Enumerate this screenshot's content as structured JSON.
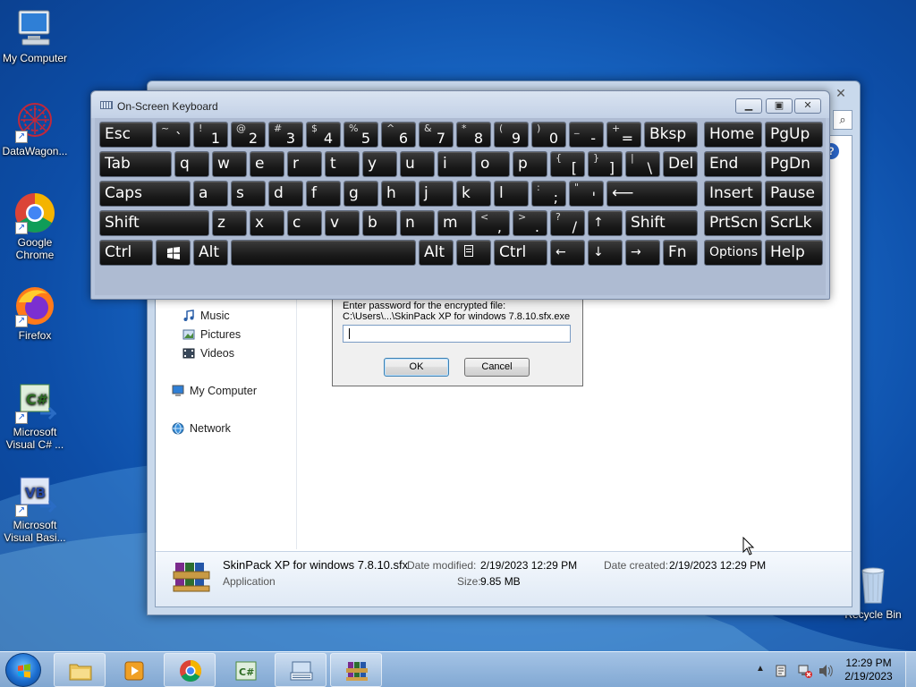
{
  "desktop": {
    "icons": [
      {
        "label": "My Computer"
      },
      {
        "label": "DataWagon..."
      },
      {
        "label": "Google Chrome"
      },
      {
        "label": "Firefox"
      },
      {
        "label": "Microsoft Visual C# ..."
      },
      {
        "label": "Microsoft Visual Basi..."
      },
      {
        "label": "Recycle Bin"
      }
    ]
  },
  "explorer": {
    "nav": [
      "Music",
      "Pictures",
      "Videos",
      "My Computer",
      "Network"
    ],
    "details": {
      "file_name": "SkinPack XP for windows 7.8.10.sfx",
      "file_type": "Application",
      "date_modified_label": "Date modified:",
      "date_modified": "2/19/2023 12:29 PM",
      "date_created_label": "Date created:",
      "date_created": "2/19/2023 12:29 PM",
      "size_label": "Size:",
      "size": "9.85 MB"
    }
  },
  "password_dialog": {
    "prompt": "Enter password for the encrypted file:",
    "path": "C:\\Users\\...\\SkinPack XP for windows 7.8.10.sfx.exe",
    "password_value": "",
    "ok_label": "OK",
    "cancel_label": "Cancel"
  },
  "osk": {
    "title": "On-Screen Keyboard",
    "keys": {
      "esc": "Esc",
      "tab": "Tab",
      "caps": "Caps",
      "shift_l": "Shift",
      "shift_r": "Shift",
      "ctrl_l": "Ctrl",
      "ctrl_r": "Ctrl",
      "alt_l": "Alt",
      "alt_r": "Alt",
      "bksp": "Bksp",
      "del": "Del",
      "enter": "⟵",
      "home": "Home",
      "pgup": "PgUp",
      "end": "End",
      "pgdn": "PgDn",
      "insert": "Insert",
      "pause": "Pause",
      "prtscn": "PrtScn",
      "scrlk": "ScrLk",
      "options": "Options",
      "help": "Help",
      "fn": "Fn",
      "row1": [
        [
          "~",
          "`"
        ],
        [
          "!",
          "1"
        ],
        [
          "@",
          "2"
        ],
        [
          "#",
          "3"
        ],
        [
          "$",
          "4"
        ],
        [
          "%",
          "5"
        ],
        [
          "^",
          "6"
        ],
        [
          "&",
          "7"
        ],
        [
          "*",
          "8"
        ],
        [
          "(",
          "9"
        ],
        [
          ")",
          "0"
        ],
        [
          "_",
          "-"
        ],
        [
          "+",
          "="
        ]
      ],
      "row2": [
        "q",
        "w",
        "e",
        "r",
        "t",
        "y",
        "u",
        "i",
        "o",
        "p"
      ],
      "row2_sym": [
        [
          "{",
          "["
        ],
        [
          "}",
          "]"
        ],
        [
          "|",
          "\\"
        ]
      ],
      "row3": [
        "a",
        "s",
        "d",
        "f",
        "g",
        "h",
        "j",
        "k",
        "l"
      ],
      "row3_sym": [
        [
          ":",
          ";"
        ],
        [
          "\"",
          "'"
        ]
      ],
      "row4": [
        "z",
        "x",
        "c",
        "v",
        "b",
        "n",
        "m"
      ],
      "row4_sym": [
        [
          "<",
          ","
        ],
        [
          ">",
          "."
        ],
        [
          "?",
          "/"
        ]
      ],
      "up": "↑",
      "left": "←",
      "down": "↓",
      "right": "→"
    }
  },
  "taskbar": {
    "time": "12:29 PM",
    "date": "2/19/2023"
  }
}
